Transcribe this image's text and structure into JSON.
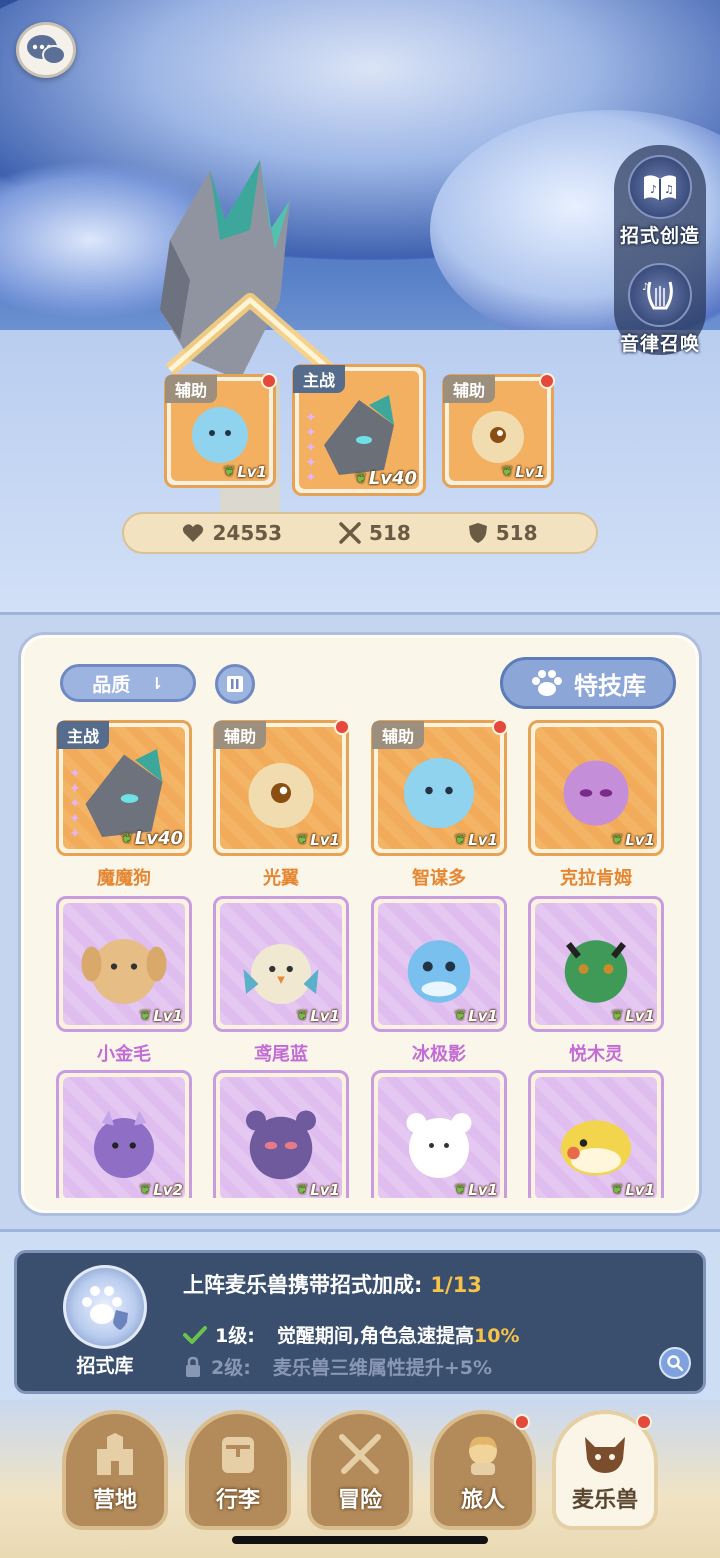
{
  "side_buttons": [
    {
      "label": "招式创造",
      "icon": "book-music-icon"
    },
    {
      "label": "音律召唤",
      "icon": "lyre-icon"
    }
  ],
  "team": [
    {
      "role": "辅助",
      "level": "Lv1",
      "color": "#8fd3ee",
      "has_dot": true
    },
    {
      "role": "主战",
      "level": "Lv40",
      "color": "#6b6f78",
      "has_dot": false
    },
    {
      "role": "辅助",
      "level": "Lv1",
      "color": "#f0dcae",
      "has_dot": true
    }
  ],
  "stats": {
    "hp": "24553",
    "attack": "518",
    "defense": "518"
  },
  "filters": {
    "quality_label": "品质",
    "skill_library_label": "特技库"
  },
  "pets": [
    {
      "name": "魔魔狗",
      "role": "主战",
      "level": "Lv40",
      "rarity": "orange",
      "color": "#6e727c"
    },
    {
      "name": "光翼",
      "role": "辅助",
      "level": "Lv1",
      "rarity": "orange",
      "color": "#f0dcae"
    },
    {
      "name": "智谋多",
      "role": "辅助",
      "level": "Lv1",
      "rarity": "orange",
      "color": "#8fd3ee"
    },
    {
      "name": "克拉肯姆",
      "role": "",
      "level": "Lv1",
      "rarity": "orange",
      "color": "#c58ed8"
    },
    {
      "name": "小金毛",
      "role": "",
      "level": "Lv1",
      "rarity": "purple",
      "color": "#e6bd85"
    },
    {
      "name": "鸢尾蓝",
      "role": "",
      "level": "Lv1",
      "rarity": "purple",
      "color": "#f1e8d2"
    },
    {
      "name": "冰极影",
      "role": "",
      "level": "Lv1",
      "rarity": "purple",
      "color": "#79c0ee"
    },
    {
      "name": "悦木灵",
      "role": "",
      "level": "Lv1",
      "rarity": "purple",
      "color": "#3f9a57"
    },
    {
      "name": "",
      "role": "",
      "level": "Lv2",
      "rarity": "purple",
      "color": "#8f6fc6"
    },
    {
      "name": "",
      "role": "",
      "level": "Lv1",
      "rarity": "purple",
      "color": "#6e5a9c"
    },
    {
      "name": "",
      "role": "",
      "level": "Lv1",
      "rarity": "purple",
      "color": "#ffffff"
    },
    {
      "name": "",
      "role": "",
      "level": "Lv1",
      "rarity": "purple",
      "color": "#f3d44d"
    }
  ],
  "bonus": {
    "icon_label": "招式库",
    "title": "上阵麦乐兽携带招式加成:",
    "count": "1/13",
    "level1_label": "1级:",
    "level1_text": "觉醒期间,角色急速提高",
    "level1_value": "10%",
    "level2_label": "2级:",
    "level2_text": "麦乐兽三维属性提升+5%"
  },
  "nav": [
    {
      "label": "营地",
      "icon": "castle-icon",
      "active": false,
      "dot": false
    },
    {
      "label": "行李",
      "icon": "backpack-icon",
      "active": false,
      "dot": false
    },
    {
      "label": "冒险",
      "icon": "crossed-swords-icon",
      "active": false,
      "dot": false
    },
    {
      "label": "旅人",
      "icon": "traveler-icon",
      "active": false,
      "dot": true
    },
    {
      "label": "麦乐兽",
      "icon": "cat-face-icon",
      "active": true,
      "dot": true
    }
  ]
}
